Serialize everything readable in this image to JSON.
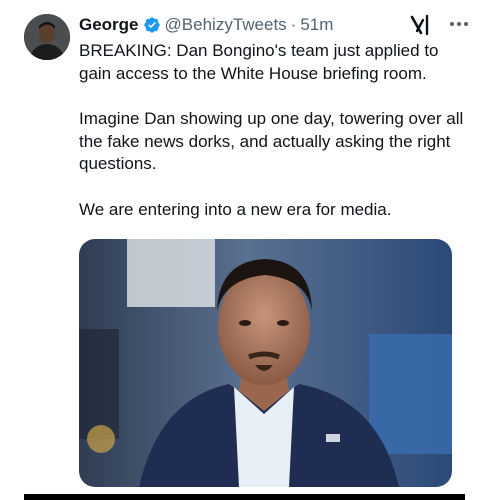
{
  "author": {
    "display_name": "George",
    "handle": "@BehizyTweets",
    "separator": "·",
    "timestamp": "51m",
    "verified": true
  },
  "tweet": {
    "paragraphs": [
      "BREAKING: Dan Bongino's team just applied to gain access to the White House briefing room.",
      "Imagine Dan showing up one day, towering over all the fake news dorks, and actually asking the right questions.",
      "We are entering into a new era for media."
    ]
  },
  "icons": {
    "verified": "verified-badge-icon",
    "grok": "grok-icon",
    "more": "more-options-icon"
  },
  "colors": {
    "text": "#0f1419",
    "secondary": "#536471",
    "verified": "#1d9bf0"
  }
}
